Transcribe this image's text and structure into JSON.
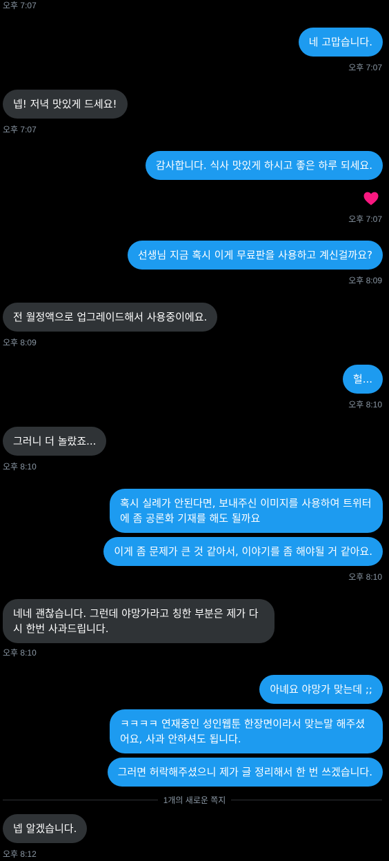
{
  "timestamp_top": "오후 7:07",
  "messages": [
    {
      "text": "네 고맙습니다.",
      "time": "오후 7:07"
    },
    {
      "text": "넵! 저녁 맛있게 드세요!",
      "time": "오후 7:07"
    },
    {
      "text": "감사합니다. 식사 맛있게 하시고 좋은 하루 되세요.",
      "time": "오후 7:07",
      "reaction": "heart-icon"
    },
    {
      "text": "선생님 지금 혹시 이게 무료판을 사용하고 계신걸까요?",
      "time": "오후 8:09"
    },
    {
      "text": "전 월정액으로 업그레이드해서 사용중이에요.",
      "time": "오후 8:09"
    },
    {
      "text": "헐...",
      "time": "오후 8:10"
    },
    {
      "text": "그러니 더 놀랐죠...",
      "time": "오후 8:10"
    },
    {
      "text": "혹시 실례가 안된다면, 보내주신 이미지를 사용하여 트위터에 좀 공론화 기재를 해도 될까요"
    },
    {
      "text": "이게 좀 문제가 큰 것 같아서, 이야기를 좀 해야될 거 같아요.",
      "time": "오후 8:10"
    },
    {
      "text": "네네 괜찮습니다. 그런데 야망가라고 칭한 부분은 제가 다시 한번 사과드립니다.",
      "time": "오후 8:10"
    },
    {
      "text": "아녜요 야망가 맞는데 ;;"
    },
    {
      "text": "ㅋㅋㅋㅋ 연재중인 성인웹툰 한장면이라서 맞는말 해주셨어요, 사과 안하셔도 됩니다."
    },
    {
      "text": "그러면 허락해주셨으니 제가 글 정리해서 한 번 쓰겠습니다."
    },
    {
      "text": "넵 알겠습니다.",
      "time": "오후 8:12"
    }
  ],
  "divider_label": "1개의 새로운 쪽지",
  "colors": {
    "outgoing": "#1d9bf0",
    "incoming": "#2f3336",
    "heart": "#f91880"
  }
}
